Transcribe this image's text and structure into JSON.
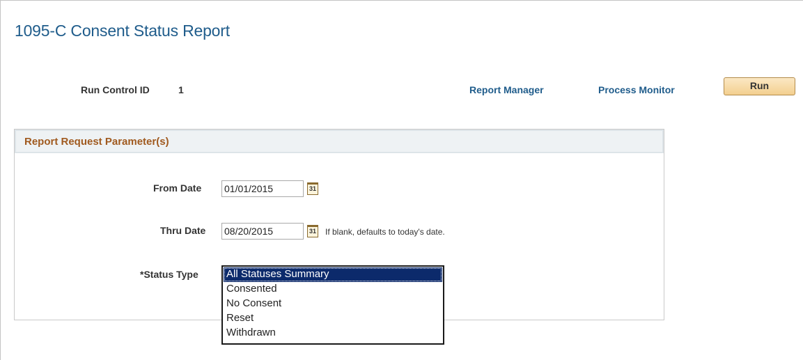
{
  "page": {
    "title": "1095-C Consent Status Report"
  },
  "run_control": {
    "label": "Run Control ID",
    "value": "1"
  },
  "links": {
    "report_manager": "Report Manager",
    "process_monitor": "Process Monitor"
  },
  "toolbar": {
    "run_label": "Run"
  },
  "group": {
    "title": "Report Request Parameter(s)"
  },
  "from_date": {
    "label": "From Date",
    "value": "01/01/2015",
    "icon": "calendar-icon",
    "icon_text": "31"
  },
  "thru_date": {
    "label": "Thru Date",
    "value": "08/20/2015",
    "icon": "calendar-icon",
    "icon_text": "31",
    "hint": "If blank, defaults to today's date."
  },
  "status_type": {
    "label": "*Status Type",
    "options": [
      "All Statuses Summary",
      "Consented",
      "No Consent",
      "Reset",
      "Withdrawn"
    ],
    "selected_index": 0
  },
  "colors": {
    "title": "#1f5c8b",
    "link": "#1f5c8b",
    "group_title": "#a05a1f",
    "selected_option_bg": "#0c2a6b",
    "run_button_bg": "#f3cf8f"
  }
}
